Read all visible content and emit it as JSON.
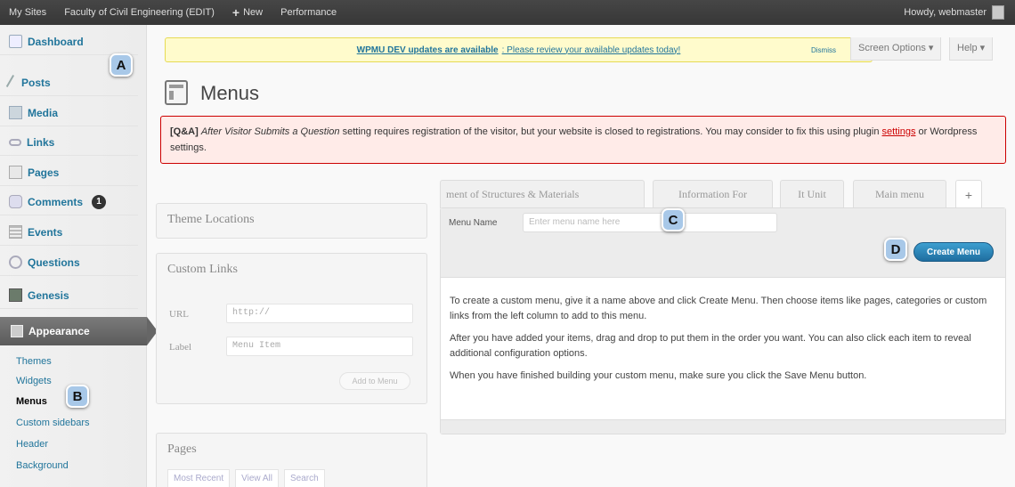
{
  "adminbar": {
    "my_sites": "My Sites",
    "site_name": "Faculty of Civil Engineering (EDIT)",
    "new": "New",
    "performance": "Performance",
    "howdy": "Howdy, webmaster"
  },
  "sidebar": {
    "items": [
      {
        "label": "Dashboard"
      },
      {
        "label": "Posts"
      },
      {
        "label": "Media"
      },
      {
        "label": "Links"
      },
      {
        "label": "Pages"
      },
      {
        "label": "Comments",
        "badge": "1"
      },
      {
        "label": "Events"
      },
      {
        "label": "Questions"
      },
      {
        "label": "Genesis"
      },
      {
        "label": "Appearance"
      }
    ],
    "submenu": [
      "Themes",
      "Widgets",
      "Menus",
      "Custom sidebars",
      "Header",
      "Background"
    ]
  },
  "markers": {
    "a": "A",
    "b": "B",
    "c": "C",
    "d": "D"
  },
  "nag": {
    "link": "WPMU DEV updates are available",
    "text": ": Please review your available updates today!",
    "dismiss": "Dismiss"
  },
  "screen_options": "Screen Options ▾",
  "help": "Help ▾",
  "page": {
    "title": "Menus"
  },
  "notice": {
    "tag": "[Q&A]",
    "setting_name": "After Visitor Submits a Question",
    "text1": " setting requires registration of the visitor, but your website is closed to registrations. You may consider to fix this using plugin ",
    "settings_link": "settings",
    "text2": " or Wordpress settings."
  },
  "left_boxes": {
    "theme_locations": "Theme Locations",
    "custom_links": {
      "title": "Custom Links",
      "url_label": "URL",
      "url_value": "http://",
      "label_label": "Label",
      "label_placeholder": "Menu Item",
      "add_button": "Add to Menu"
    },
    "pages": {
      "title": "Pages",
      "tabs": [
        "Most Recent",
        "View All",
        "Search"
      ]
    }
  },
  "menu_tabs": [
    "ment of Structures & Materials",
    "Information For",
    "It Unit",
    "Main menu",
    "+"
  ],
  "menu_edit": {
    "name_label": "Menu Name",
    "name_placeholder": "Enter menu name here",
    "create_button": "Create Menu",
    "p1": "To create a custom menu, give it a name above and click Create Menu. Then choose items like pages, categories or custom links from the left column to add to this menu.",
    "p2": "After you have added your items, drag and drop to put them in the order you want. You can also click each item to reveal additional configuration options.",
    "p3": "When you have finished building your custom menu, make sure you click the Save Menu button."
  }
}
